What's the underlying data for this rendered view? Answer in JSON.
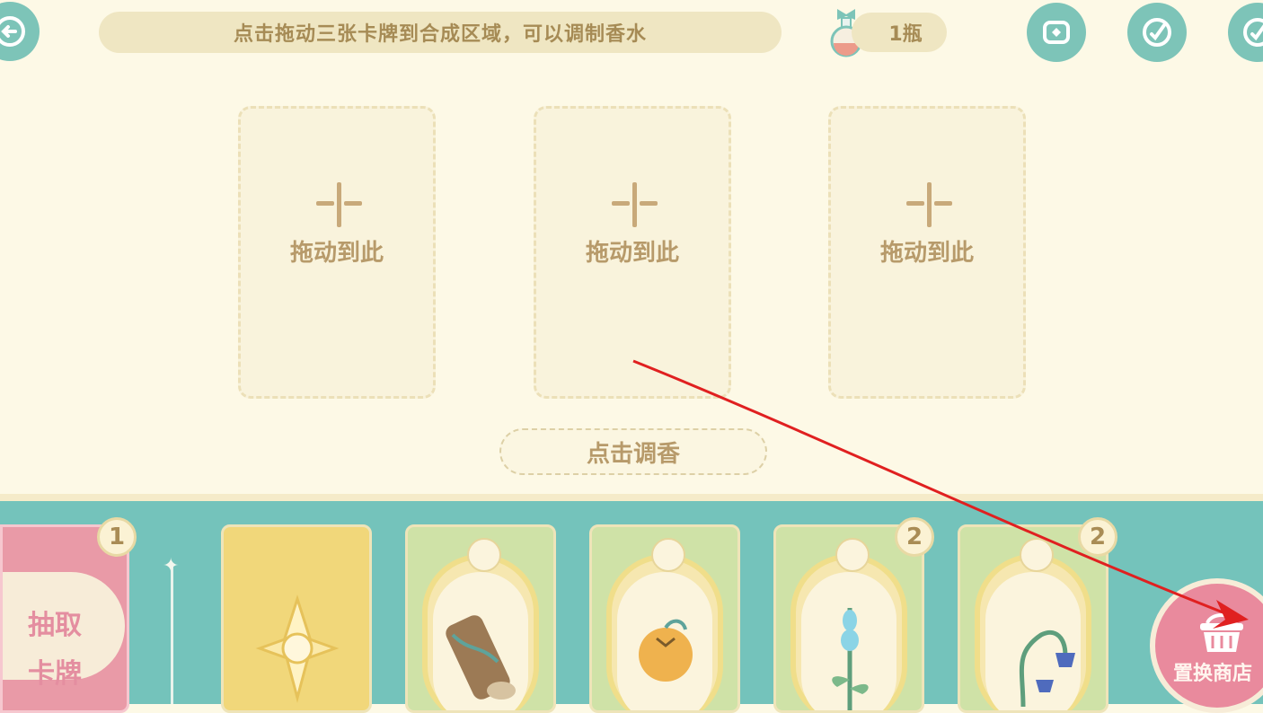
{
  "top": {
    "hint": "点击拖动三张卡牌到合成区域，可以调制香水",
    "bottle_count": "1瓶"
  },
  "slots": [
    {
      "label": "拖动到此"
    },
    {
      "label": "拖动到此"
    },
    {
      "label": "拖动到此"
    }
  ],
  "mix_button": "点击调香",
  "draw_card": {
    "line1": "抽取",
    "line2": "卡牌",
    "badge": "1"
  },
  "cards": [
    {
      "name": "star-card"
    },
    {
      "name": "wood-card"
    },
    {
      "name": "orange-card"
    },
    {
      "name": "blue-flower-card",
      "badge": "2"
    },
    {
      "name": "bellflower-card",
      "badge": "2"
    }
  ],
  "shop_button": "置换商店",
  "colors": {
    "background": "#fdf9e6",
    "teal": "#74c3bb",
    "pink": "#e99aa7",
    "text_brown": "#a68b55"
  }
}
